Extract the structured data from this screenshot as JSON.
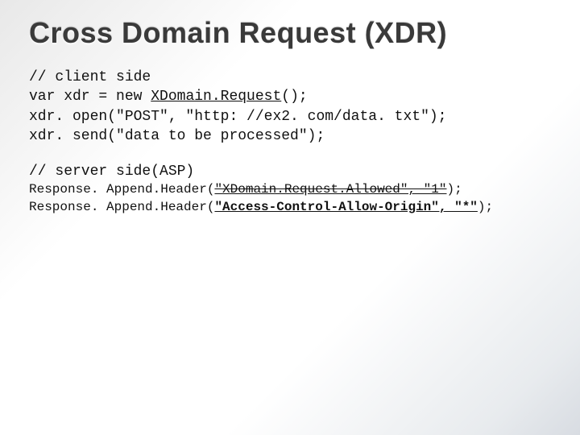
{
  "title": "Cross Domain Request (XDR)",
  "client": {
    "line1": "// client side",
    "line2_a": "var xdr = new ",
    "line2_b": "XDomain.Request",
    "line2_c": "();",
    "line3": "xdr. open(\"POST\", \"http: //ex2. com/data. txt\");",
    "line4": "xdr. send(\"data to be processed\");"
  },
  "server": {
    "heading": "// server side(ASP)",
    "line1_a": "Response. Append.Header(",
    "line1_b": "\"XDomain.Request.Allowed\", \"1\"",
    "line1_c": ");",
    "line2_a": "Response. Append.Header(",
    "line2_b": "\"Access-Control-Allow-Origin\", \"*\"",
    "line2_c": ");"
  }
}
